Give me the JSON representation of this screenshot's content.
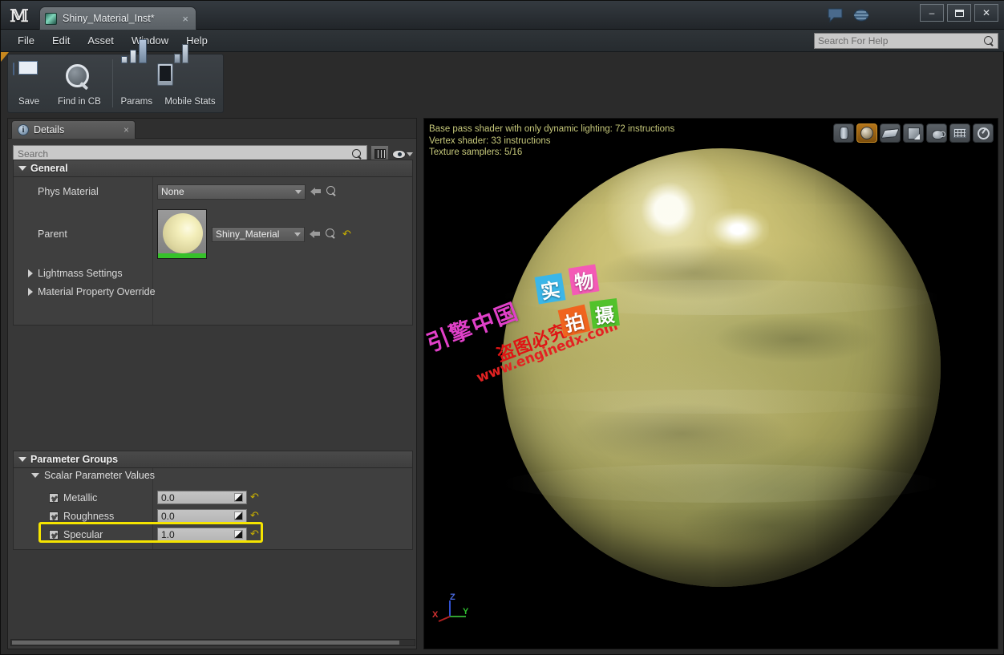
{
  "window": {
    "logo": "ue-logo",
    "tab_title": "Shiny_Material_Inst*",
    "tab_close": "×",
    "feedback_icon": "speech-bubble-icon",
    "globe_icon": "globe-icon",
    "minimize": "–",
    "maximize": "⬜",
    "close": "✕"
  },
  "menu": {
    "items": [
      "File",
      "Edit",
      "Asset",
      "Window",
      "Help"
    ],
    "help_search_placeholder": "Search For Help",
    "help_search_icon": "search-icon"
  },
  "toolbar": {
    "buttons": [
      {
        "label": "Save",
        "icon": "floppy-disk-icon"
      },
      {
        "label": "Find in CB",
        "icon": "magnifier-icon"
      },
      {
        "label": "Params",
        "icon": "bar-chart-icon"
      },
      {
        "label": "Mobile Stats",
        "icon": "mobile-device-icon"
      }
    ]
  },
  "details": {
    "tab_label": "Details",
    "tab_icon": "info-icon",
    "tab_close": "×",
    "search_placeholder": "Search",
    "search_icon": "search-icon",
    "grid_toggle_icon": "grid-view-icon",
    "eye_icon": "visibility-eye-icon",
    "eye_caret": "chevron-down-icon",
    "general": {
      "title": "General",
      "phys_material": {
        "label": "Phys Material",
        "value": "None",
        "back_icon": "use-selected-arrow-icon",
        "browse_icon": "browse-magnifier-icon"
      },
      "parent": {
        "label": "Parent",
        "value": "Shiny_Material",
        "thumbnail": "sphere-thumbnail",
        "back_icon": "use-selected-arrow-icon",
        "browse_icon": "browse-magnifier-icon",
        "reset_icon": "reset-arrow-icon"
      },
      "sub_sections": [
        {
          "label": "Lightmass Settings",
          "expander": "chevron-right-icon"
        },
        {
          "label": "Material Property Override",
          "expander": "chevron-right-icon"
        }
      ]
    },
    "parameter_groups": {
      "title": "Parameter Groups",
      "scalar_group": "Scalar Parameter Values",
      "rows": [
        {
          "label": "Metallic",
          "value": "0.0",
          "checked": true,
          "highlighted": false
        },
        {
          "label": "Roughness",
          "value": "0.0",
          "checked": true,
          "highlighted": false
        },
        {
          "label": "Specular",
          "value": "1.0",
          "checked": true,
          "highlighted": true
        }
      ],
      "spinner_icon": "drag-spinner-icon",
      "reset_icon": "reset-arrow-icon",
      "highlight_color": "#f5e400"
    }
  },
  "viewport": {
    "shader_stats": "Base pass shader with only dynamic lighting: 72 instructions\nVertex shader: 33 instructions\nTexture samplers: 5/16",
    "stats_color": "#c6c87a",
    "toolbar_buttons": [
      {
        "icon": "cylinder-mesh-icon",
        "active": false
      },
      {
        "icon": "sphere-mesh-icon",
        "active": true
      },
      {
        "icon": "plane-mesh-icon",
        "active": false
      },
      {
        "icon": "cube-mesh-icon",
        "active": false
      },
      {
        "icon": "teapot-mesh-icon",
        "active": false
      },
      {
        "icon": "grid-toggle-icon",
        "active": false
      },
      {
        "icon": "viewport-settings-icon",
        "active": false
      }
    ],
    "gizmo": {
      "x": "X",
      "y": "Y",
      "z": "Z",
      "x_color": "#d03030",
      "y_color": "#30c030",
      "z_color": "#3050d0"
    },
    "watermark": {
      "brand": "引擎中国",
      "url": "www.enginedx.com",
      "warning": "盗图必究",
      "chips": [
        {
          "text": "实",
          "color": "#3ab6e8"
        },
        {
          "text": "物",
          "color": "#f45ab6"
        },
        {
          "text": "拍",
          "color": "#f0641e"
        },
        {
          "text": "摄",
          "color": "#52c22b"
        }
      ]
    }
  }
}
